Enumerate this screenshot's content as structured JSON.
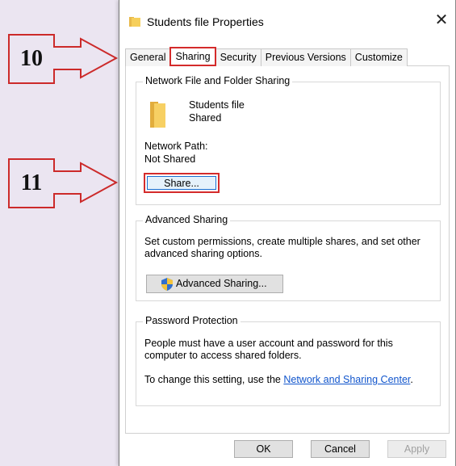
{
  "callouts": [
    {
      "number": "10",
      "target": "sharing-tab"
    },
    {
      "number": "11",
      "target": "share-button"
    }
  ],
  "dialog": {
    "title": "Students file Properties",
    "tabs": [
      "General",
      "Sharing",
      "Security",
      "Previous Versions",
      "Customize"
    ],
    "active_tab": "Sharing",
    "network_sharing": {
      "group_title": "Network File and Folder Sharing",
      "folder_name": "Students file",
      "folder_status": "Shared",
      "network_path_label": "Network Path:",
      "network_path_value": "Not Shared",
      "share_button": "Share..."
    },
    "advanced_sharing": {
      "group_title": "Advanced Sharing",
      "description": "Set custom permissions, create multiple shares, and set other advanced sharing options.",
      "button": "Advanced Sharing..."
    },
    "password_protection": {
      "group_title": "Password Protection",
      "description": "People must have a user account and password for this computer to access shared folders.",
      "change_prefix": "To change this setting, use the ",
      "link_text": "Network and Sharing Center",
      "change_suffix": "."
    },
    "footer": {
      "ok": "OK",
      "cancel": "Cancel",
      "apply": "Apply"
    }
  }
}
